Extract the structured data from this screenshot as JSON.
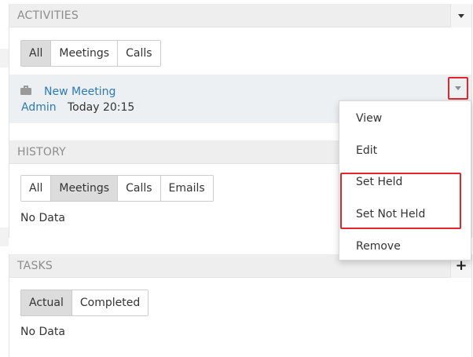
{
  "activities": {
    "title": "ACTIVITIES",
    "tabs": [
      {
        "label": "All",
        "active": true
      },
      {
        "label": "Meetings",
        "active": false
      },
      {
        "label": "Calls",
        "active": false
      }
    ],
    "items": [
      {
        "name": "New Meeting",
        "user": "Admin",
        "time": "Today 20:15",
        "icon": "briefcase-icon"
      }
    ]
  },
  "menu": {
    "items": [
      "View",
      "Edit",
      "Set Held",
      "Set Not Held",
      "Remove"
    ]
  },
  "history": {
    "title": "HISTORY",
    "tabs": [
      {
        "label": "All",
        "active": false
      },
      {
        "label": "Meetings",
        "active": true
      },
      {
        "label": "Calls",
        "active": false
      },
      {
        "label": "Emails",
        "active": false
      }
    ],
    "empty_text": "No Data"
  },
  "tasks": {
    "title": "TASKS",
    "tabs": [
      {
        "label": "Actual",
        "active": true
      },
      {
        "label": "Completed",
        "active": false
      }
    ],
    "empty_text": "No Data"
  },
  "colors": {
    "highlight": "#e0262b",
    "link": "#2a7ab8",
    "header_bg": "#eeeeee",
    "row_bg": "#edf0f2"
  }
}
